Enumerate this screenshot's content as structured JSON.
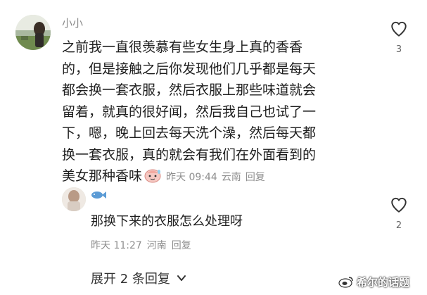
{
  "comment": {
    "username": "小小",
    "lines": [
      "之前我一直很羡慕有些女生身上真的香香",
      "的，但是接触之后你发现他们几乎都是每天",
      "都会换一套衣服，然后衣服上那些味道就会",
      "留着，就真的很好闻，然后我自己也试了一",
      "下，嗯，晚上回去每天洗个澡，然后每天都",
      "换一套衣服，真的就会有我们在外面看到的"
    ],
    "last_line": "美女那种香味",
    "time": "昨天 09:44",
    "location": "云南",
    "reply_label": "回复",
    "like_count": "3",
    "icons": {
      "like": "heart-outline-icon",
      "emoji": "sweaty-face-emoji-icon"
    }
  },
  "reply": {
    "badge_icon": "fish-badge-icon",
    "text": "那换下来的衣服怎么处理呀",
    "time": "昨天 11:27",
    "location": "河南",
    "reply_label": "回复",
    "like_count": "2"
  },
  "expand_replies": {
    "label": "展开 2 条回复",
    "icon": "chevron-down-icon"
  },
  "watermark": {
    "text": "希尔的话题"
  },
  "colors": {
    "meta_gray": "#8e8e8e",
    "text": "#1e1e1e",
    "badge_blue": "#5b9bd5"
  }
}
